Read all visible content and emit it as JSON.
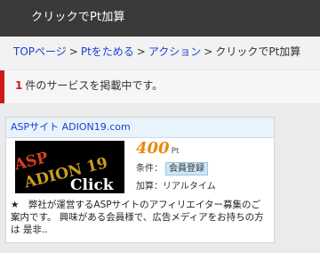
{
  "header": {
    "title": "クリックでPt加算"
  },
  "breadcrumb": {
    "items": [
      "TOPページ",
      "Ptをためる",
      "アクション"
    ],
    "current": "クリックでPt加算",
    "separator": ">"
  },
  "notice": {
    "count": "1",
    "text": "件のサービスを掲載中です。"
  },
  "listing": {
    "title": "ASPサイト ADION19.com",
    "banner": {
      "line1": "ASP",
      "line2": "ADION 19",
      "line3": "Click"
    },
    "points_value": "400",
    "points_unit": "Pt",
    "condition_label": "条件：",
    "condition_badge": "会員登録",
    "timing_text": "加算：リアルタイム",
    "description": "★　弊社が運営するASPサイトのアフィリエイター募集のご案内です。 興味がある会員様で、広告メディアをお持ちの方は 是非.."
  },
  "colors": {
    "header_bg": "#3a3a3a",
    "link": "#1a3fd4",
    "accent_red": "#cc1a1a",
    "points_orange": "#e88a10",
    "card_header_bg": "#e8f3fb",
    "badge_bg": "#cfe6f7"
  }
}
